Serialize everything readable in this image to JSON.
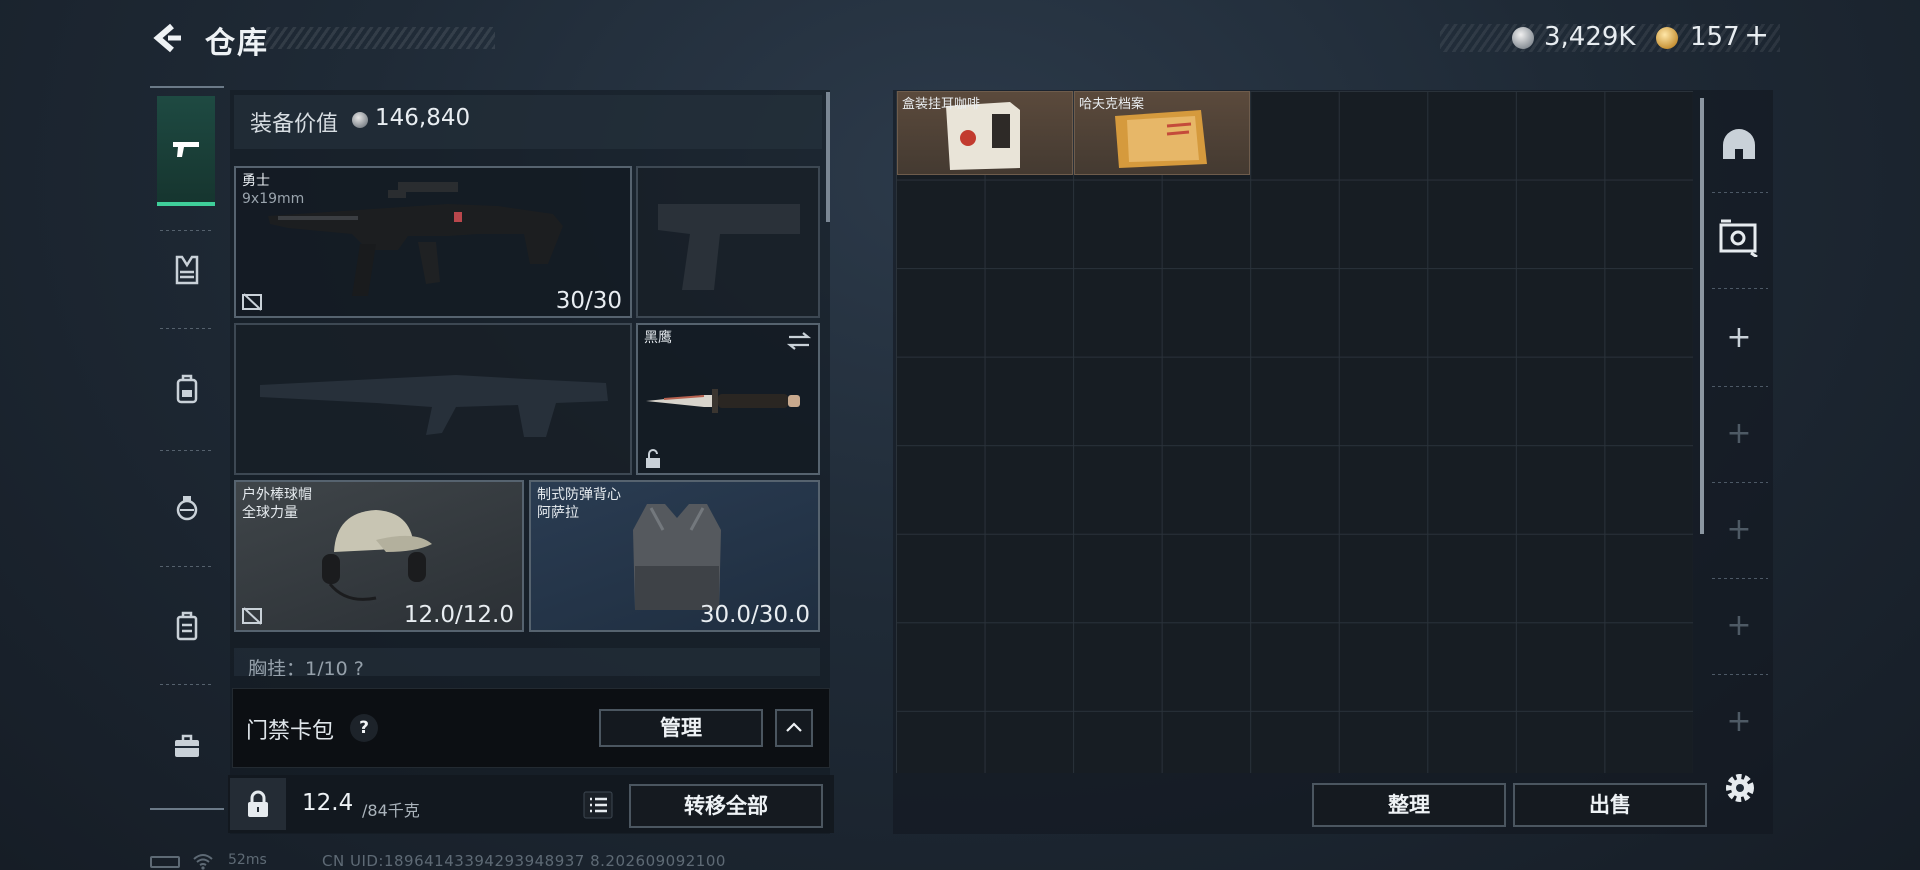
{
  "header": {
    "title": "仓库",
    "silver_amount": "3,429K",
    "gold_amount": "157",
    "add_label": "+"
  },
  "left_rail": {
    "items": [
      {
        "icon": "pistol-icon",
        "active": true
      },
      {
        "icon": "chest-rig-icon",
        "active": false
      },
      {
        "icon": "backpack-icon",
        "active": false
      },
      {
        "icon": "grenade-icon",
        "active": false
      },
      {
        "icon": "case-icon",
        "active": false
      },
      {
        "icon": "toolbox-icon",
        "active": false
      }
    ]
  },
  "equipment": {
    "value_label": "装备价值",
    "value_amount": "146,840",
    "slots": {
      "primary": {
        "name": "勇士",
        "caliber": "9x19mm",
        "count": "30/30"
      },
      "melee": {
        "name": "黑鹰"
      },
      "helmet": {
        "name": "户外棒球帽",
        "sub": "全球力量",
        "durability": "12.0/12.0"
      },
      "armor": {
        "name": "制式防弹背心",
        "sub": "阿萨拉",
        "durability": "30.0/30.0"
      },
      "chest": {
        "label": "胸挂：1/10 ?"
      }
    },
    "keycard": {
      "label": "门禁卡包",
      "help": "?",
      "manage": "管理"
    },
    "weight": {
      "current": "12.4",
      "max": "/84千克"
    },
    "transfer_all": "转移全部"
  },
  "storage": {
    "items": [
      {
        "name": "盒装挂耳咖啡"
      },
      {
        "name": "哈夫克档案"
      }
    ],
    "sort_label": "整理",
    "sell_label": "出售",
    "tools": [
      {
        "icon": "helmet-icon"
      },
      {
        "icon": "safe-box-icon"
      },
      {
        "icon": "plus-icon"
      },
      {
        "icon": "plus-icon"
      },
      {
        "icon": "plus-icon"
      },
      {
        "icon": "plus-icon"
      },
      {
        "icon": "plus-icon"
      }
    ]
  },
  "status": {
    "ping": "52ms",
    "uid": "CN UID:18964143394293948937 8.202609092100"
  },
  "colors": {
    "accent_green": "#3fcf9a",
    "background": "#1f2a36"
  }
}
